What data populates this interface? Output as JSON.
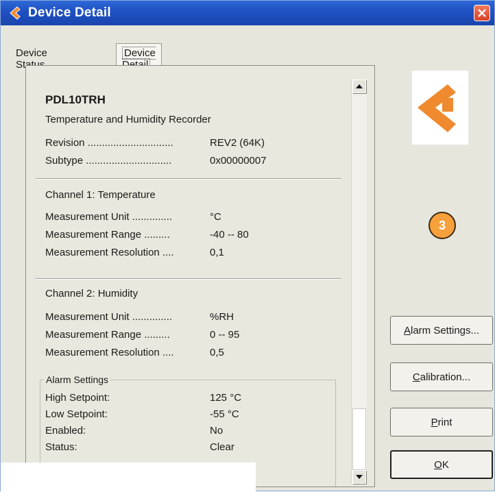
{
  "window": {
    "title": "Device Detail"
  },
  "tabs": [
    {
      "label": "Device Status"
    },
    {
      "label": "Device Detail"
    }
  ],
  "device": {
    "name": "PDL10TRH",
    "description": "Temperature and Humidity Recorder",
    "revision_label": "Revision ..............................",
    "revision_value": "REV2 (64K)",
    "subtype_label": "Subtype ..............................",
    "subtype_value": "0x00000007"
  },
  "channel1": {
    "title": "Channel 1: Temperature",
    "unit_label": "Measurement Unit ..............",
    "unit_value": "°C",
    "range_label": "Measurement Range .........",
    "range_value": "-40 -- 80",
    "resolution_label": "Measurement Resolution ....",
    "resolution_value": "0,1"
  },
  "channel2": {
    "title": "Channel 2: Humidity",
    "unit_label": "Measurement Unit ..............",
    "unit_value": "%RH",
    "range_label": "Measurement Range .........",
    "range_value": "0 -- 95",
    "resolution_label": "Measurement Resolution ....",
    "resolution_value": "0,5"
  },
  "alarm": {
    "title": "Alarm Settings",
    "high_label": "High Setpoint:",
    "high_value": "125 °C",
    "low_label": "Low Setpoint:",
    "low_value": "-55 °C",
    "enabled_label": "Enabled:",
    "enabled_value": "No",
    "status_label": "Status:",
    "status_value": "Clear"
  },
  "badge": {
    "value": "3"
  },
  "buttons": {
    "alarm_settings_mn": "A",
    "alarm_settings_rest": "larm Settings...",
    "calibration_mn": "C",
    "calibration_rest": "alibration...",
    "print_mn": "P",
    "print_rest": "rint",
    "ok_mn": "O",
    "ok_rest": "K"
  },
  "colors": {
    "titlebar": "#1f52c2",
    "logo_accent": "#f08a2e",
    "badge": "#f7a13c"
  },
  "icons": {
    "title": "arrow-logo-icon",
    "close": "close-icon",
    "logo": "arrow-logo-icon"
  }
}
